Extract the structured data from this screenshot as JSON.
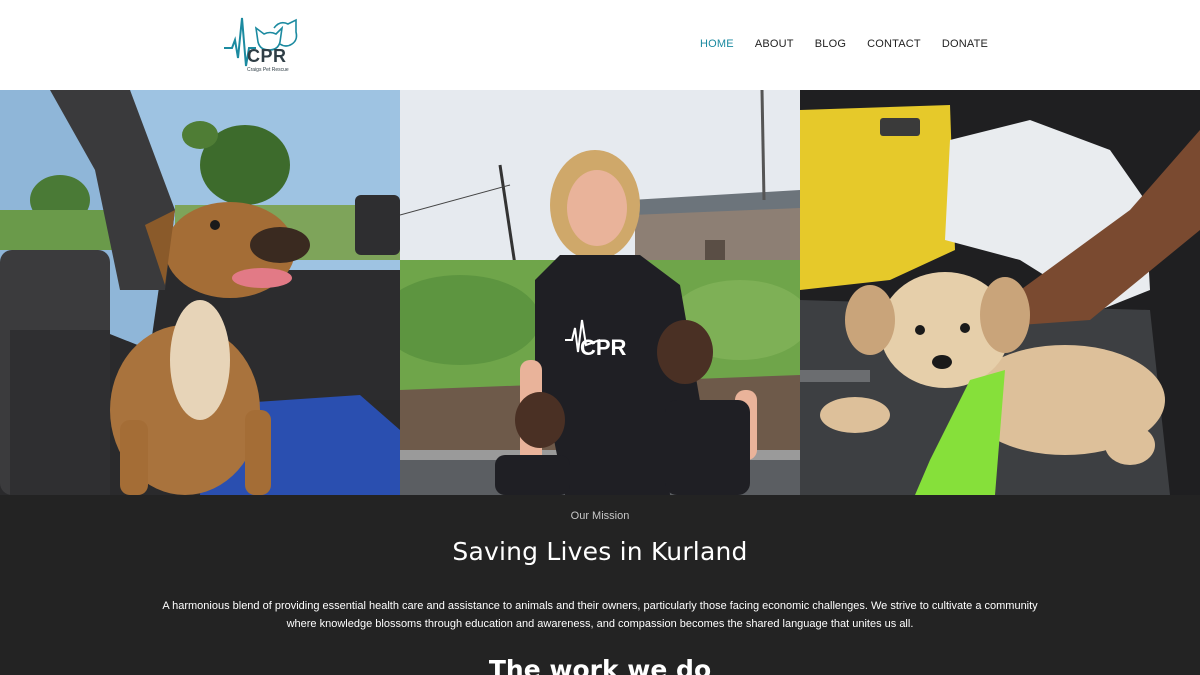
{
  "brand": {
    "logo_text": "CPR",
    "logo_subtext": "Craigs Pet Rescue",
    "accent_color": "#1b8aa0",
    "logo_color": "#2f3e46"
  },
  "nav": {
    "items": [
      {
        "label": "HOME",
        "active": true
      },
      {
        "label": "ABOUT",
        "active": false
      },
      {
        "label": "BLOG",
        "active": false
      },
      {
        "label": "CONTACT",
        "active": false
      },
      {
        "label": "DONATE",
        "active": false
      }
    ]
  },
  "photos": [
    {
      "name": "dog-in-car-photo"
    },
    {
      "name": "volunteer-with-children-photo"
    },
    {
      "name": "puppy-with-green-cast-photo"
    }
  ],
  "mission": {
    "eyebrow": "Our Mission",
    "title": "Saving Lives in Kurland",
    "description": "A harmonious blend of providing essential health care and assistance to animals and their owners, particularly those facing economic challenges. We strive to cultivate a community where knowledge blossoms through education and awareness, and compassion becomes the shared language that unites us all.",
    "next_heading": "The work we do",
    "background": "#232323"
  }
}
